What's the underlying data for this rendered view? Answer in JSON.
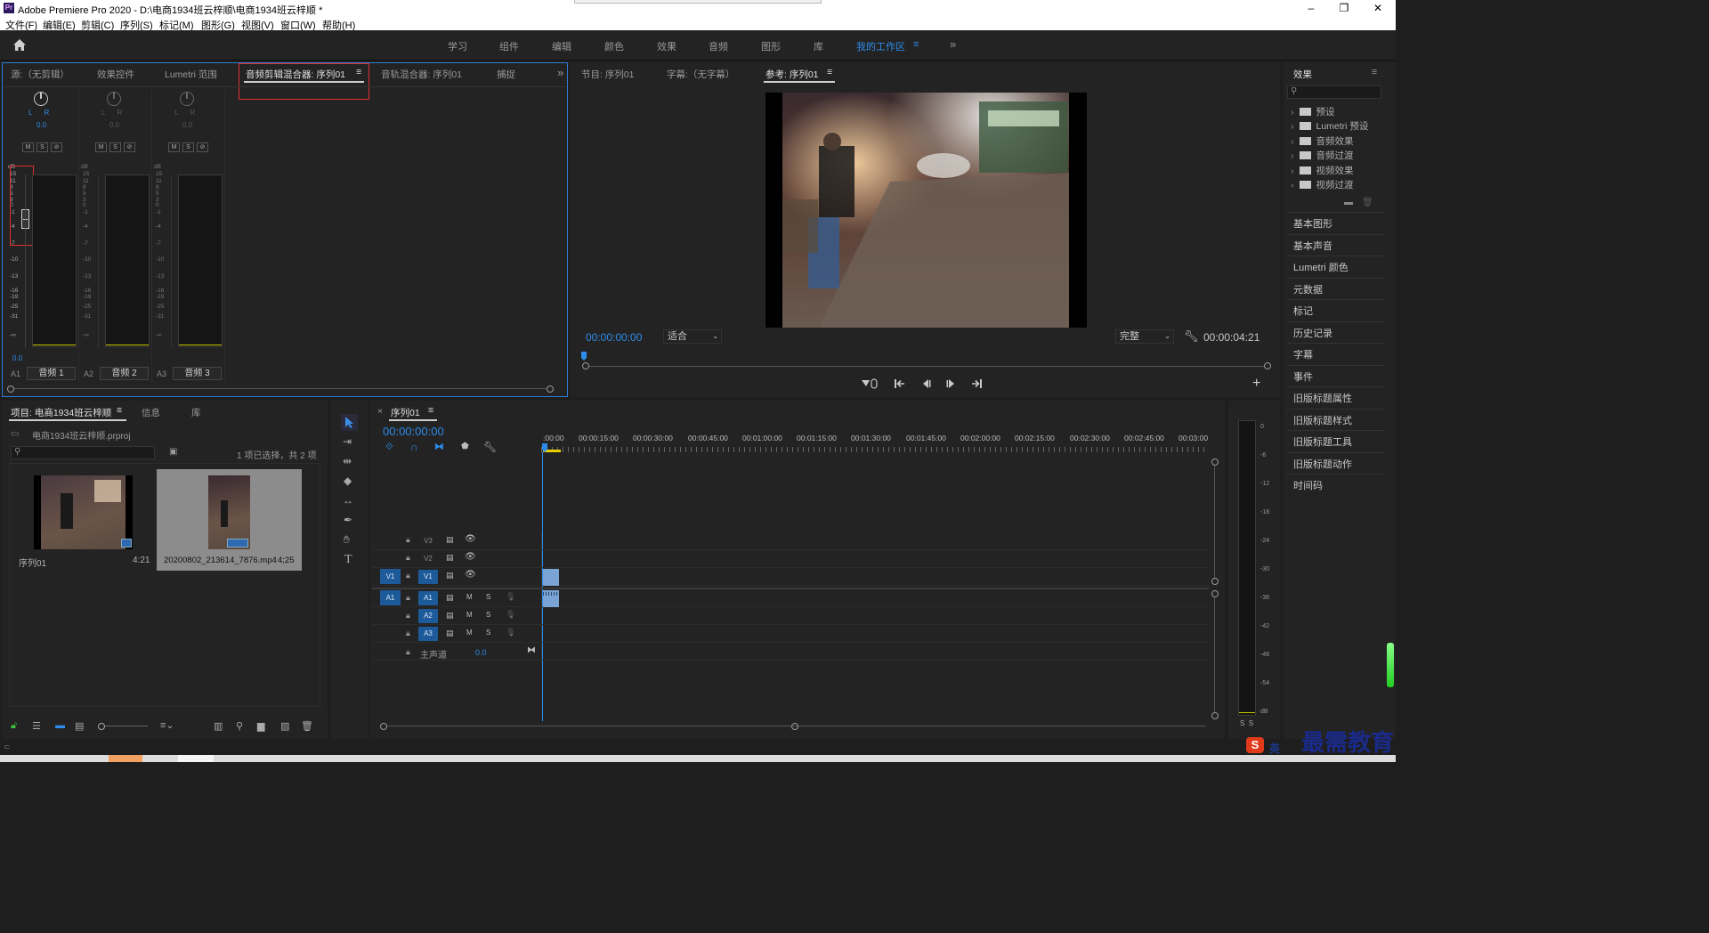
{
  "window": {
    "title": "Adobe Premiere Pro 2020 - D:\\电商1934班云梓顺\\电商1934班云梓顺 *",
    "minimize": "–",
    "maximize": "❐",
    "close": "✕"
  },
  "menu": [
    "文件(F)",
    "编辑(E)",
    "剪辑(C)",
    "序列(S)",
    "标记(M)",
    "图形(G)",
    "视图(V)",
    "窗口(W)",
    "帮助(H)"
  ],
  "workspaces": {
    "items": [
      "学习",
      "组件",
      "编辑",
      "颜色",
      "效果",
      "音频",
      "图形",
      "库"
    ],
    "active": "我的工作区",
    "more": "»"
  },
  "mixer_panel": {
    "tabs": [
      "源:（无剪辑）",
      "效果控件",
      "Lumetri 范围",
      "音频剪辑混合器: 序列01",
      "音轨混合器: 序列01",
      "捕捉"
    ],
    "more": "»",
    "lr": "L      R",
    "pan_value": "0.0",
    "msb": [
      "M",
      "S",
      "⊘"
    ],
    "db_label": "dB",
    "scale": [
      "15",
      "11",
      "8",
      "5",
      "3",
      "0",
      "-1",
      "-4",
      "-7",
      "-10",
      "-13",
      "-16",
      "-19",
      "-25",
      "-31",
      "-∞"
    ],
    "volume_value": "0.0",
    "channels": [
      {
        "id": "A1",
        "name": "音频 1"
      },
      {
        "id": "A2",
        "name": "音频 2"
      },
      {
        "id": "A3",
        "name": "音频 3"
      }
    ]
  },
  "program_panel": {
    "tabs": [
      "节目: 序列01",
      "字幕:（无字幕）",
      "参考: 序列01"
    ],
    "timecode": "00:00:00:00",
    "fit": "适合",
    "quality": "完整",
    "duration": "00:00:04:21",
    "add": "+"
  },
  "effects_panel": {
    "title": "效果",
    "tree": [
      "预设",
      "Lumetri 预设",
      "音频效果",
      "音频过渡",
      "视频效果",
      "视频过渡"
    ],
    "items": [
      "基本图形",
      "基本声音",
      "Lumetri 颜色",
      "元数据",
      "标记",
      "历史记录",
      "字幕",
      "事件",
      "旧版标题属性",
      "旧版标题样式",
      "旧版标题工具",
      "旧版标题动作",
      "时间码"
    ]
  },
  "project_panel": {
    "tabs": [
      "项目: 电商1934班云梓顺",
      "信息",
      "库"
    ],
    "file": "电商1934班云梓顺.prproj",
    "selection": "1 项已选择，共 2 项",
    "items": [
      {
        "name": "序列01",
        "duration": "4:21"
      },
      {
        "name": "20200802_213614_7876.mp4",
        "duration": "4;25"
      }
    ]
  },
  "timeline": {
    "tab": "序列01",
    "timecode": "00:00:00:00",
    "ruler": [
      ":00:00",
      "00:00:15:00",
      "00:00:30:00",
      "00:00:45:00",
      "00:01:00:00",
      "00:01:15:00",
      "00:01:30:00",
      "00:01:45:00",
      "00:02:00:00",
      "00:02:15:00",
      "00:02:30:00",
      "00:02:45:00",
      "00:03:00"
    ],
    "video_tracks": [
      "V3",
      "V2",
      "V1"
    ],
    "audio_tracks": [
      "A1",
      "A2",
      "A3"
    ],
    "source_v": "V1",
    "source_a": "A1",
    "master": "主声道",
    "master_value": "0.0",
    "m": "M",
    "s": "S"
  },
  "audio_meter": {
    "scale": [
      "0",
      "-6",
      "-12",
      "-18",
      "-24",
      "-30",
      "-36",
      "-42",
      "-48",
      "-54",
      "dB"
    ],
    "solo": "S  S"
  },
  "watermark": "最需教育",
  "ime": "英"
}
